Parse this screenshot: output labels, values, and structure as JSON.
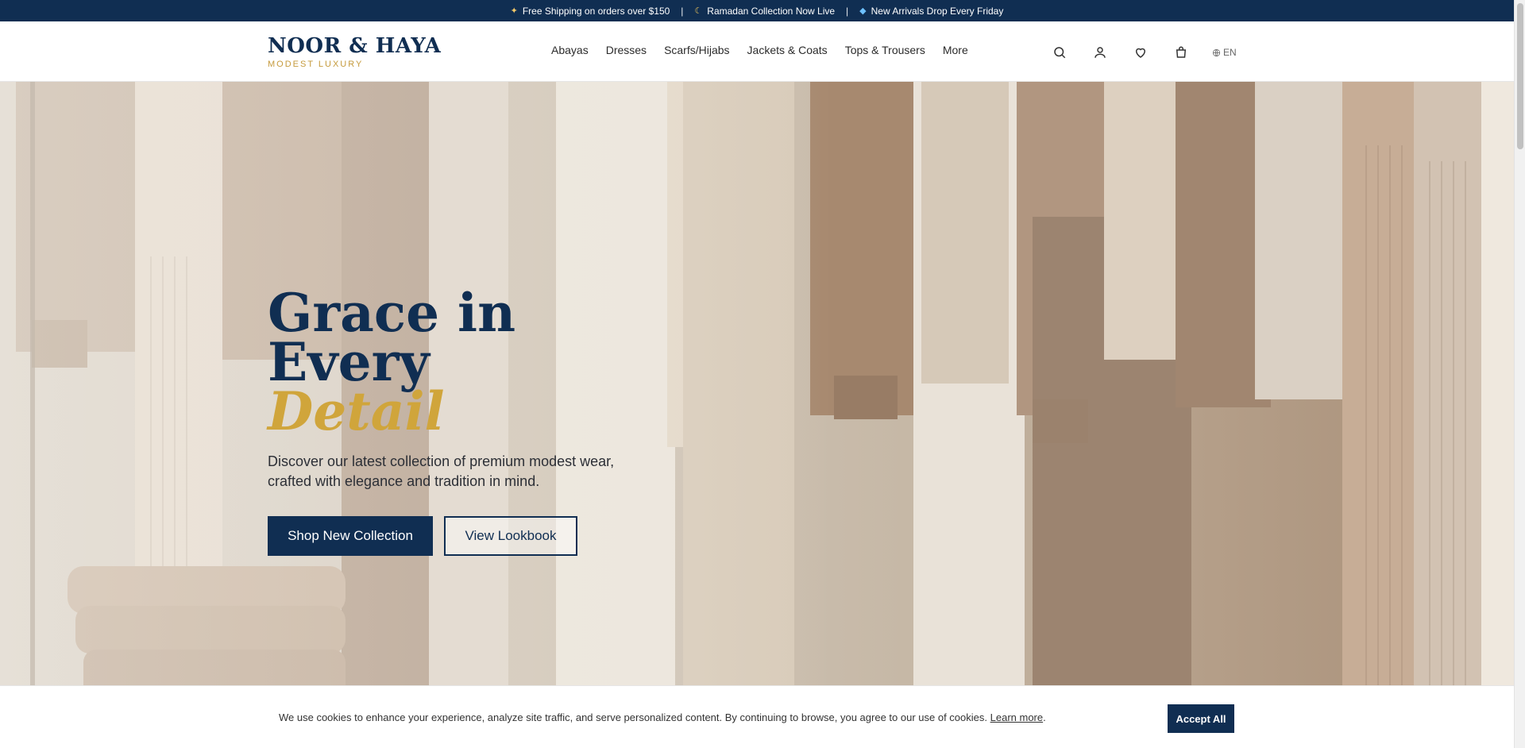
{
  "announcement": {
    "items": [
      {
        "icon": "sparkles-icon",
        "text": "Free Shipping on orders over $150"
      },
      {
        "icon": "moon-icon",
        "text": "Ramadan Collection Now Live"
      },
      {
        "icon": "gem-icon",
        "text": "New Arrivals Drop Every Friday"
      }
    ],
    "separator": "|"
  },
  "brand": {
    "name": "NOOR & HAYA",
    "tagline": "MODEST LUXURY"
  },
  "nav": {
    "items": [
      "Abayas",
      "Dresses",
      "Scarfs/Hijabs",
      "Jackets & Coats",
      "Tops & Trousers",
      "More"
    ]
  },
  "header_icons": [
    "search-icon",
    "user-icon",
    "heart-icon",
    "bag-icon"
  ],
  "language": {
    "icon": "globe-icon",
    "code": "EN"
  },
  "hero": {
    "title_line1": "Grace in Every",
    "title_accent": "Detail",
    "subtitle": "Discover our latest collection of premium modest wear, crafted with elegance and tradition in mind.",
    "primary_button": "Shop New Collection",
    "secondary_button": "View Lookbook"
  },
  "cookie": {
    "text": "We use cookies to enhance your experience, analyze site traffic, and serve personalized content. By continuing to browse, you agree to our use of cookies.",
    "link": "Learn more",
    "accept": "Accept All"
  },
  "colors": {
    "navy": "#102e52",
    "gold": "#d0a53b",
    "beige": "#cfc4b6"
  }
}
